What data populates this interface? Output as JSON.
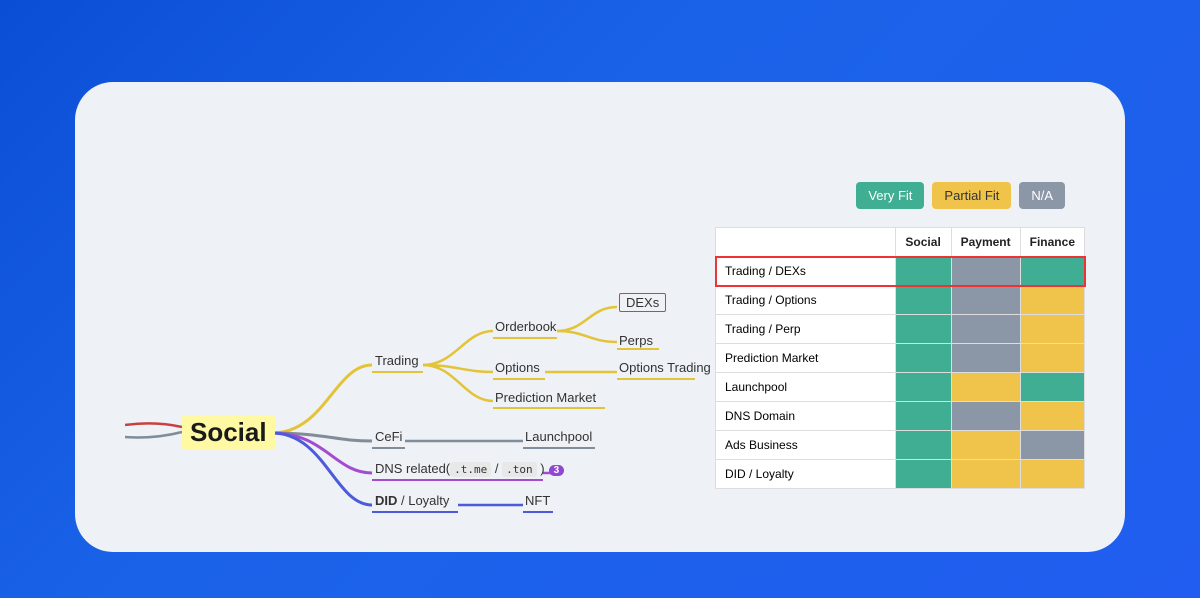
{
  "root": "Social",
  "mindmap": {
    "branch1": {
      "label": "Trading",
      "children": {
        "orderbook": {
          "label": "Orderbook",
          "leaf1": "DEXs",
          "leaf2": "Perps"
        },
        "options": {
          "label": "Options",
          "leaf": "Options Trading"
        },
        "prediction": {
          "label": "Prediction Market"
        }
      }
    },
    "branch2": {
      "label": "CeFi",
      "leaf": "Launchpool"
    },
    "branch3": {
      "label": "DNS related(",
      "code1": ".t.me",
      "sep": " / ",
      "code2": ".ton",
      "close": " )",
      "badge": "3"
    },
    "branch4": {
      "prefix": "DID",
      "rest": " / Loyalty",
      "leaf": "NFT"
    }
  },
  "legend": {
    "veryfit": "Very Fit",
    "partial": "Partial Fit",
    "na": "N/A"
  },
  "matrix": {
    "headers": {
      "c1": "Social",
      "c2": "Payment",
      "c3": "Finance"
    },
    "rows": [
      {
        "label": "Trading / DEXs",
        "c1": "green",
        "c2": "gray",
        "c3": "green",
        "highlight": true
      },
      {
        "label": "Trading / Options",
        "c1": "green",
        "c2": "gray",
        "c3": "yellow"
      },
      {
        "label": "Trading / Perp",
        "c1": "green",
        "c2": "gray",
        "c3": "yellow"
      },
      {
        "label": "Prediction Market",
        "c1": "green",
        "c2": "gray",
        "c3": "yellow"
      },
      {
        "label": "Launchpool",
        "c1": "green",
        "c2": "yellow",
        "c3": "green"
      },
      {
        "label": "DNS Domain",
        "c1": "green",
        "c2": "gray",
        "c3": "yellow"
      },
      {
        "label": "Ads Business",
        "c1": "green",
        "c2": "yellow",
        "c3": "gray"
      },
      {
        "label": "DID / Loyalty",
        "c1": "green",
        "c2": "yellow",
        "c3": "yellow"
      }
    ]
  }
}
